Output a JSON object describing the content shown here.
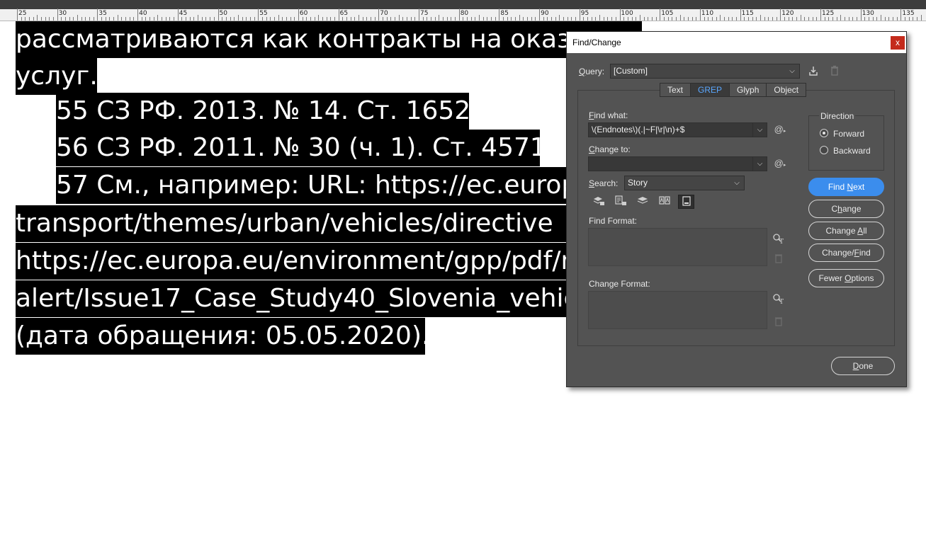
{
  "ruler": {
    "labels": [
      "25",
      "30",
      "35",
      "40",
      "45",
      "50",
      "55",
      "60",
      "65",
      "70",
      "75",
      "80",
      "85",
      "90",
      "95",
      "100",
      "105",
      "110",
      "115",
      "120",
      "125",
      "130",
      "135"
    ]
  },
  "document": {
    "lines": [
      "рассматриваются как контракты на оказ",
      "услуг.",
      "55 СЗ РФ. 2013. № 14. Ст. 1652.",
      "56 СЗ РФ. 2011. № 30 (ч. 1). Ст. 4571.",
      "57 См., например: URL: https://ec.europ",
      "transport/themes/urban/vehicles/directive",
      "https://ec.europa.eu/environment/gpp/pdf/n",
      "alert/Issue17_Case_Study40_Slovenia_vehicl",
      "(дата обращения: 05.05.2020)."
    ]
  },
  "dialog": {
    "title": "Find/Change",
    "close_glyph": "x",
    "query": {
      "label_pre": "",
      "label_u": "Q",
      "label_post": "uery:",
      "value": "[Custom]"
    },
    "tabs": [
      {
        "label": "Text",
        "active": false
      },
      {
        "label": "GREP",
        "active": true
      },
      {
        "label": "Glyph",
        "active": false
      },
      {
        "label": "Object",
        "active": false
      }
    ],
    "find_what": {
      "label_u": "F",
      "label_post": "ind what:",
      "value": "\\(Endnotes\\)(.|~F|\\r|\\n)+$"
    },
    "change_to": {
      "label_u": "C",
      "label_post": "hange to:",
      "value": ""
    },
    "search": {
      "label_u": "S",
      "label_post": "earch:",
      "value": "Story"
    },
    "direction": {
      "title": "Direction",
      "forward": "Forward",
      "backward": "Backward",
      "selected": "Forward"
    },
    "buttons": {
      "find_next": "Find Next",
      "change": "Change",
      "change_all": "Change All",
      "change_find": "Change/Find",
      "fewer_options": "Fewer Options",
      "done": "Done"
    },
    "find_format_label": "Find Format:",
    "change_format_label": "Change Format:",
    "at_symbol": "@",
    "colors": {
      "accent": "#3b8ded",
      "active_tab_text": "#5aa7ff",
      "panel_bg": "#535353",
      "close_bg": "#c42b1c"
    }
  }
}
